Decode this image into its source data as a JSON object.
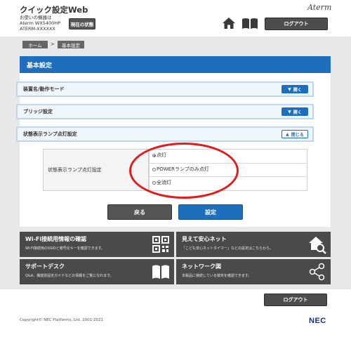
{
  "header": {
    "app_title": "クイック設定Web",
    "device_caption": "お使いの機器は",
    "device_model": "Aterm WX5400HP",
    "device_id": "ATERM-XXXXXX",
    "status_button": "現在の状態",
    "brand": "Aterm",
    "logout": "ログアウト"
  },
  "breadcrumb": {
    "home": "ホーム",
    "separator": ">",
    "current": "基本設定"
  },
  "panel": {
    "title": "基本設定",
    "sections": [
      {
        "label": "装置名/動作モード",
        "toggle": "開く",
        "state": "collapsed"
      },
      {
        "label": "ブリッジ設定",
        "toggle": "開く",
        "state": "collapsed"
      },
      {
        "label": "状態表示ランプ点灯設定",
        "toggle": "閉じる",
        "state": "expanded"
      }
    ],
    "setting": {
      "label": "状態表示ランプ点灯設定",
      "options": [
        {
          "label": "点灯",
          "selected": true
        },
        {
          "label": "POWERランプのみ点灯",
          "selected": false
        },
        {
          "label": "全消灯",
          "selected": false
        }
      ]
    },
    "back_button": "戻る",
    "set_button": "設定"
  },
  "tiles": [
    {
      "title": "Wi-Fi接続用情報の確認",
      "desc": "Wi-Fi接続用のSSIDと暗号化キーを確認できます。",
      "icon": "qr-code-icon"
    },
    {
      "title": "見えて安心ネット",
      "desc": "「こども安心ネットタイマー」などの設定はこちらから。",
      "icon": "home-search-icon"
    },
    {
      "title": "サポートデスク",
      "desc": "Q&A、機能別設定ガイドなどの情報をご覧になれます。",
      "icon": "book-icon"
    },
    {
      "title": "ネットワーク図",
      "desc": "本製品に接続している端末を確認できます。",
      "icon": "network-share-icon"
    }
  ],
  "footer": {
    "logout": "ログアウト",
    "copyright": "Copyright© NEC Platforms, Ltd. 2001-2021",
    "logo": "NEC"
  },
  "colors": {
    "primary": "#1d6fbd",
    "dark_button": "#4d4d4d",
    "highlight": "#e21b1b",
    "band": "#e8e8e8"
  }
}
